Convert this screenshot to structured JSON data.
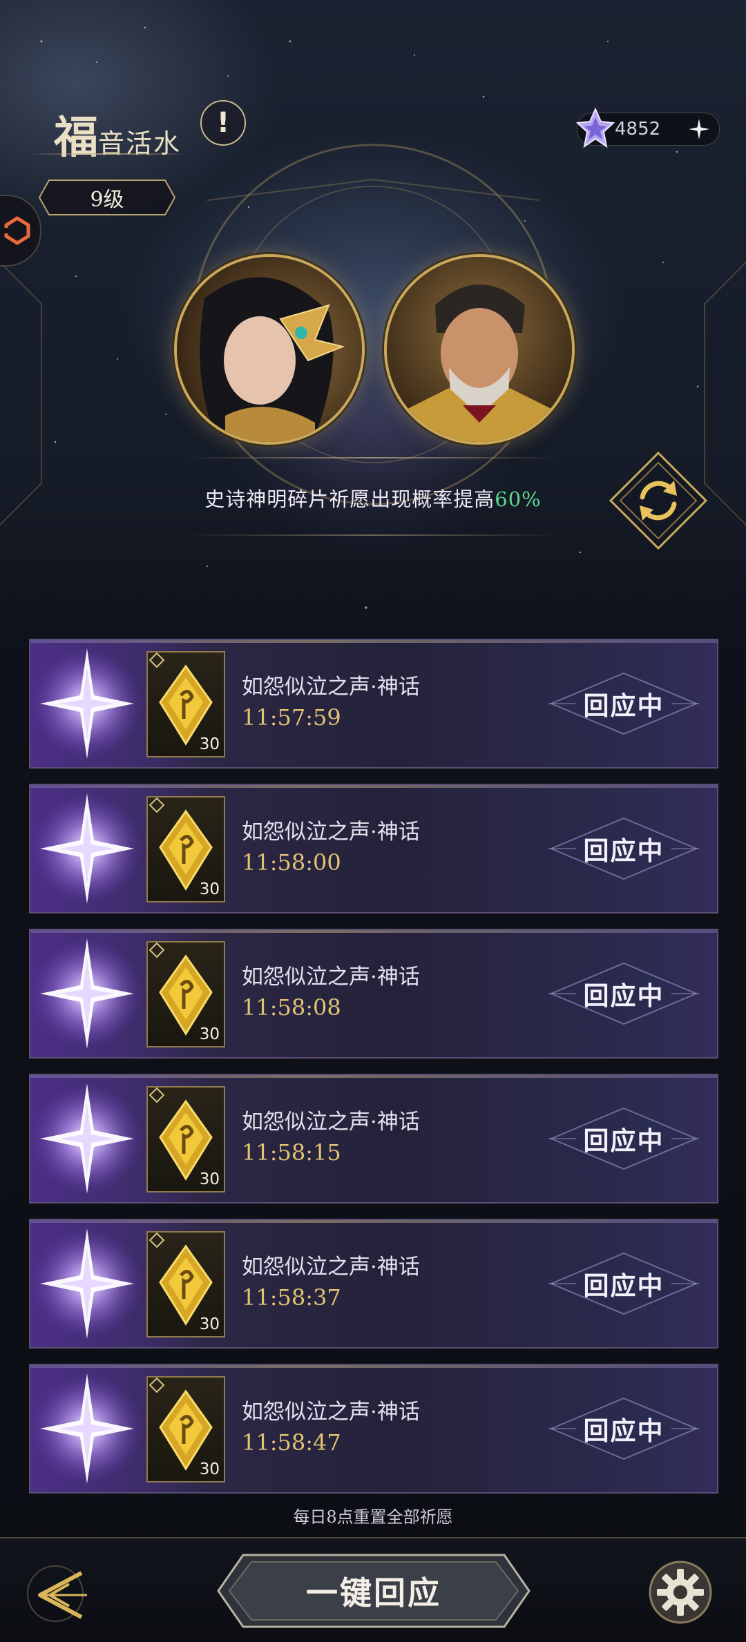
{
  "header": {
    "title_first_char": "福",
    "title_rest": "音活水",
    "level": "9级",
    "currency_value": "4852",
    "icons": {
      "info": "exclamation-icon",
      "currency": "star-crystal-icon",
      "add": "plus-sparkle-icon",
      "side": "side-tab-icon"
    }
  },
  "banner": {
    "notice_text": "史诗神明碎片祈愿出现概率提高",
    "notice_highlight": "60%",
    "highlight_color": "#5fd58e",
    "refresh_icon": "refresh-icon"
  },
  "wishes": [
    {
      "name": "如怨似泣之声·神话",
      "time": "11:57:59",
      "count": "30",
      "button": "回应中"
    },
    {
      "name": "如怨似泣之声·神话",
      "time": "11:58:00",
      "count": "30",
      "button": "回应中"
    },
    {
      "name": "如怨似泣之声·神话",
      "time": "11:58:08",
      "count": "30",
      "button": "回应中"
    },
    {
      "name": "如怨似泣之声·神话",
      "time": "11:58:15",
      "count": "30",
      "button": "回应中"
    },
    {
      "name": "如怨似泣之声·神话",
      "time": "11:58:37",
      "count": "30",
      "button": "回应中"
    },
    {
      "name": "如怨似泣之声·神话",
      "time": "11:58:47",
      "count": "30",
      "button": "回应中"
    }
  ],
  "footer": {
    "reset_note": "每日8点重置全部祈愿",
    "one_key_label": "一键回应",
    "back_icon": "back-arrow-icon",
    "settings_icon": "gear-icon"
  },
  "colors": {
    "gold": "#caa85a",
    "time_gold": "#e2c373",
    "row_purple": "#3d2d6a"
  }
}
